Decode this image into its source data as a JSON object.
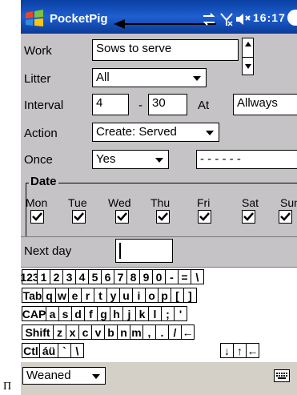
{
  "app": {
    "title": "PocketPig"
  },
  "status": {
    "time": "16:17"
  },
  "form": {
    "work": {
      "label": "Work",
      "value": "Sows to serve"
    },
    "litter": {
      "label": "Litter",
      "value": "All"
    },
    "interval": {
      "label": "Interval",
      "from": "4",
      "dash": "-",
      "to": "30",
      "at_label": "At",
      "at_value": "Allways"
    },
    "action": {
      "label": "Action",
      "value": "Create: Served"
    },
    "once": {
      "label": "Once",
      "value": "Yes",
      "second_value": "- - - - - -"
    },
    "date_group": {
      "title": "Date",
      "days": [
        {
          "label": "Mon",
          "checked": true
        },
        {
          "label": "Tue",
          "checked": true
        },
        {
          "label": "Wed",
          "checked": true
        },
        {
          "label": "Thu",
          "checked": true
        },
        {
          "label": "Fri",
          "checked": true
        },
        {
          "label": "Sat",
          "checked": true
        },
        {
          "label": "Sun",
          "checked": true
        }
      ]
    },
    "next_day": {
      "label": "Next day",
      "value": ""
    }
  },
  "keyboard": {
    "row1": [
      "123",
      "1",
      "2",
      "3",
      "4",
      "5",
      "6",
      "7",
      "8",
      "9",
      "0",
      "-",
      "=",
      "\\"
    ],
    "row2": [
      "Tab",
      "q",
      "w",
      "e",
      "r",
      "t",
      "y",
      "u",
      "i",
      "o",
      "p",
      "[",
      "]"
    ],
    "row3": [
      "CAP",
      "a",
      "s",
      "d",
      "f",
      "g",
      "h",
      "j",
      "k",
      "l",
      ";",
      "'"
    ],
    "row4": [
      "Shift",
      "z",
      "x",
      "c",
      "v",
      "b",
      "n",
      "m",
      ",",
      ".",
      "/",
      "←"
    ],
    "row5": [
      "Ctl",
      "áü",
      "`",
      "\\",
      "↓",
      "↑",
      "←"
    ]
  },
  "bottom": {
    "menu_value": "Weaned",
    "keyboard_icon": "keyboard-icon"
  },
  "corner_glyph": "П",
  "icons": {
    "windows_logo": "windows-flag-icon",
    "connectivity": "connectivity-icon",
    "signal": "signal-icon",
    "volume": "volume-icon"
  },
  "colors": {
    "titlebar": "#1e5fd0",
    "background": "#c6c3c6"
  }
}
